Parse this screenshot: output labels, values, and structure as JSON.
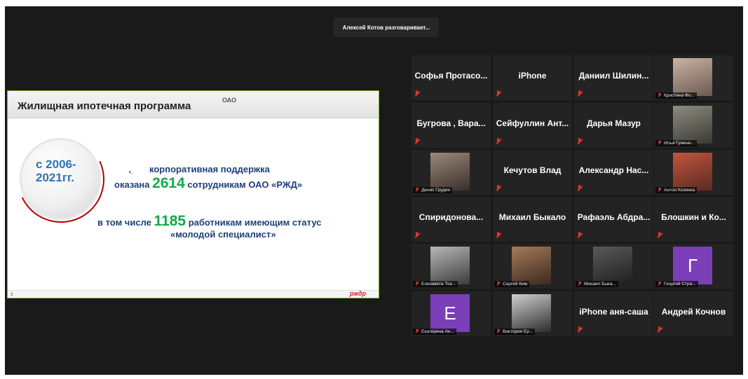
{
  "speaker_banner": "Алексей Котов разговаривает...",
  "slide": {
    "title": "Жилищная ипотечная программа",
    "title_tail": "ОАО",
    "period_line1": "с 2006-",
    "period_line2": "2021гг.",
    "line1": "корпоративная поддержка",
    "line2_prefix": "оказана",
    "line2_number": "2614",
    "line2_suffix": "сотрудникам ОАО «РЖД»",
    "line3_prefix": "в том числе",
    "line3_number": "1185",
    "line3_suffix": "работникам имеющим статус",
    "line4": "«молодой специалист»",
    "page_number": "3",
    "logo": "рждр"
  },
  "participants": [
    {
      "name": "Софья Протасо...",
      "video": false
    },
    {
      "name": "iPhone",
      "video": false
    },
    {
      "name": "Даниил Шилин...",
      "video": false
    },
    {
      "name": "Кристина Фо...",
      "video": true
    },
    {
      "name": "Бугрова , Вара...",
      "video": false
    },
    {
      "name": "Сейфуллин Ант...",
      "video": false
    },
    {
      "name": "Дарья Мазур",
      "video": false
    },
    {
      "name": "Илья Гуменн...",
      "video": true
    },
    {
      "name": "Денис Грудин",
      "video": true
    },
    {
      "name": "Кечутов Влад",
      "video": false
    },
    {
      "name": "Александр Нас...",
      "video": false
    },
    {
      "name": "Антон Козинка",
      "video": true
    },
    {
      "name": "Спиридонова...",
      "video": false
    },
    {
      "name": "Михаил Быкало",
      "video": false
    },
    {
      "name": "Рафаэль Абдра...",
      "video": false
    },
    {
      "name": "Блошкин и Ко...",
      "video": false
    },
    {
      "name": "Елизавета Тка...",
      "video": true
    },
    {
      "name": "Сергей Ким",
      "video": true
    },
    {
      "name": "Михаил Быка...",
      "video": true
    },
    {
      "name": "Георгий Стра...",
      "video": true,
      "letter": "Г"
    },
    {
      "name": "Екатерина Ан...",
      "video": true,
      "letter": "Е"
    },
    {
      "name": "Виктория Ер...",
      "video": true
    },
    {
      "name": "iPhone аня-саша",
      "video": false
    },
    {
      "name": "Андрей Кочнов",
      "video": false
    }
  ],
  "colors": {
    "background": "#1a1a1a",
    "tile": "#232323",
    "accent_green": "#12a84b",
    "slide_blue": "#1f3e78",
    "muted_mic": "#e3342f",
    "avatar_purple": "#7b3fb7"
  }
}
